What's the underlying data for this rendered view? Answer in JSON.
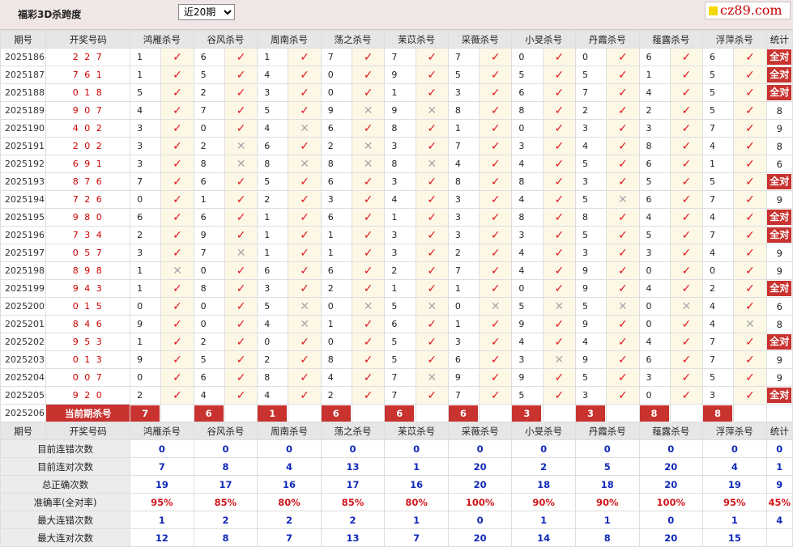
{
  "header": {
    "title": "福彩3D杀跨度",
    "period_selected": "近20期",
    "logo_text": "cz89.com"
  },
  "columns": {
    "period": "期号",
    "winning": "开奖号码",
    "stat": "统计",
    "experts": [
      "鸿雁杀号",
      "谷风杀号",
      "周南杀号",
      "荡之杀号",
      "苿苡杀号",
      "采薇杀号",
      "小旻杀号",
      "丹霞杀号",
      "薤露杀号",
      "浮萍杀号"
    ]
  },
  "rows": [
    {
      "p": "2025186",
      "w": "2 2 7",
      "v": [
        "1",
        "6",
        "1",
        "7",
        "7",
        "7",
        "0",
        "0",
        "6",
        "6"
      ],
      "r": "0000000000",
      "s": "全对"
    },
    {
      "p": "2025187",
      "w": "7 6 1",
      "v": [
        "1",
        "5",
        "4",
        "0",
        "9",
        "5",
        "5",
        "5",
        "1",
        "5"
      ],
      "r": "0000000000",
      "s": "全对"
    },
    {
      "p": "2025188",
      "w": "0 1 8",
      "v": [
        "5",
        "2",
        "3",
        "0",
        "1",
        "3",
        "6",
        "7",
        "4",
        "5"
      ],
      "r": "0000000000",
      "s": "全对"
    },
    {
      "p": "2025189",
      "w": "9 0 7",
      "v": [
        "4",
        "7",
        "5",
        "9",
        "9",
        "8",
        "8",
        "2",
        "2",
        "5"
      ],
      "r": "0001100000",
      "s": "8"
    },
    {
      "p": "2025190",
      "w": "4 0 2",
      "v": [
        "3",
        "0",
        "4",
        "6",
        "8",
        "1",
        "0",
        "3",
        "3",
        "7"
      ],
      "r": "0010000000",
      "s": "9"
    },
    {
      "p": "2025191",
      "w": "2 0 2",
      "v": [
        "3",
        "2",
        "6",
        "2",
        "3",
        "7",
        "3",
        "4",
        "8",
        "4"
      ],
      "r": "0101000000",
      "s": "8"
    },
    {
      "p": "2025192",
      "w": "6 9 1",
      "v": [
        "3",
        "8",
        "8",
        "8",
        "8",
        "4",
        "4",
        "5",
        "6",
        "1"
      ],
      "r": "0111100000",
      "s": "6"
    },
    {
      "p": "2025193",
      "w": "8 7 6",
      "v": [
        "7",
        "6",
        "5",
        "6",
        "3",
        "8",
        "8",
        "3",
        "5",
        "5"
      ],
      "r": "0000000000",
      "s": "全对"
    },
    {
      "p": "2025194",
      "w": "7 2 6",
      "v": [
        "0",
        "1",
        "2",
        "3",
        "4",
        "3",
        "4",
        "5",
        "6",
        "7"
      ],
      "r": "0000000100",
      "s": "9"
    },
    {
      "p": "2025195",
      "w": "9 8 0",
      "v": [
        "6",
        "6",
        "1",
        "6",
        "1",
        "3",
        "8",
        "8",
        "4",
        "4"
      ],
      "r": "0000000000",
      "s": "全对"
    },
    {
      "p": "2025196",
      "w": "7 3 4",
      "v": [
        "2",
        "9",
        "1",
        "1",
        "3",
        "3",
        "3",
        "5",
        "5",
        "7"
      ],
      "r": "0000000000",
      "s": "全对"
    },
    {
      "p": "2025197",
      "w": "0 5 7",
      "v": [
        "3",
        "7",
        "1",
        "1",
        "3",
        "2",
        "4",
        "3",
        "3",
        "4"
      ],
      "r": "0100000000",
      "s": "9"
    },
    {
      "p": "2025198",
      "w": "8 9 8",
      "v": [
        "1",
        "0",
        "6",
        "6",
        "2",
        "7",
        "4",
        "9",
        "0",
        "0"
      ],
      "r": "1000000000",
      "s": "9"
    },
    {
      "p": "2025199",
      "w": "9 4 3",
      "v": [
        "1",
        "8",
        "3",
        "2",
        "1",
        "1",
        "0",
        "9",
        "4",
        "2"
      ],
      "r": "0000000000",
      "s": "全对"
    },
    {
      "p": "2025200",
      "w": "0 1 5",
      "v": [
        "0",
        "0",
        "5",
        "0",
        "5",
        "0",
        "5",
        "5",
        "0",
        "4"
      ],
      "r": "0011111110",
      "s": "6"
    },
    {
      "p": "2025201",
      "w": "8 4 6",
      "v": [
        "9",
        "0",
        "4",
        "1",
        "6",
        "1",
        "9",
        "9",
        "0",
        "4"
      ],
      "r": "0010000001",
      "s": "8"
    },
    {
      "p": "2025202",
      "w": "9 5 3",
      "v": [
        "1",
        "2",
        "0",
        "0",
        "5",
        "3",
        "4",
        "4",
        "4",
        "7"
      ],
      "r": "0000000000",
      "s": "全对"
    },
    {
      "p": "2025203",
      "w": "0 1 3",
      "v": [
        "9",
        "5",
        "2",
        "8",
        "5",
        "6",
        "3",
        "9",
        "6",
        "7"
      ],
      "r": "0000001000",
      "s": "9"
    },
    {
      "p": "2025204",
      "w": "0 0 7",
      "v": [
        "0",
        "6",
        "8",
        "4",
        "7",
        "9",
        "9",
        "5",
        "3",
        "5"
      ],
      "r": "0000100000",
      "s": "9"
    },
    {
      "p": "2025205",
      "w": "9 2 0",
      "v": [
        "2",
        "4",
        "4",
        "2",
        "7",
        "7",
        "5",
        "3",
        "0",
        "3"
      ],
      "r": "0000000000",
      "s": "全对"
    }
  ],
  "current": {
    "period": "2025206",
    "label": "当前期杀号",
    "values": [
      "7",
      "6",
      "1",
      "6",
      "6",
      "6",
      "3",
      "3",
      "8",
      "8"
    ]
  },
  "stats": [
    {
      "label": "目前连错次数",
      "values": [
        "0",
        "0",
        "0",
        "0",
        "0",
        "0",
        "0",
        "0",
        "0",
        "0"
      ],
      "total": "0",
      "kind": "num"
    },
    {
      "label": "目前连对次数",
      "values": [
        "7",
        "8",
        "4",
        "13",
        "1",
        "20",
        "2",
        "5",
        "20",
        "4"
      ],
      "total": "1",
      "kind": "num"
    },
    {
      "label": "总正确次数",
      "values": [
        "19",
        "17",
        "16",
        "17",
        "16",
        "20",
        "18",
        "18",
        "20",
        "19"
      ],
      "total": "9",
      "kind": "num"
    },
    {
      "label": "准确率(全对率)",
      "values": [
        "95%",
        "85%",
        "80%",
        "85%",
        "80%",
        "100%",
        "90%",
        "90%",
        "100%",
        "95%"
      ],
      "total": "45%",
      "kind": "pct"
    },
    {
      "label": "最大连错次数",
      "values": [
        "1",
        "2",
        "2",
        "2",
        "1",
        "0",
        "1",
        "1",
        "0",
        "1"
      ],
      "total": "4",
      "kind": "num"
    },
    {
      "label": "最大连对次数",
      "values": [
        "12",
        "8",
        "7",
        "13",
        "7",
        "20",
        "14",
        "8",
        "20",
        "15"
      ],
      "total": "",
      "kind": "num"
    }
  ],
  "marks": {
    "hit": "✓",
    "miss": "✕"
  }
}
